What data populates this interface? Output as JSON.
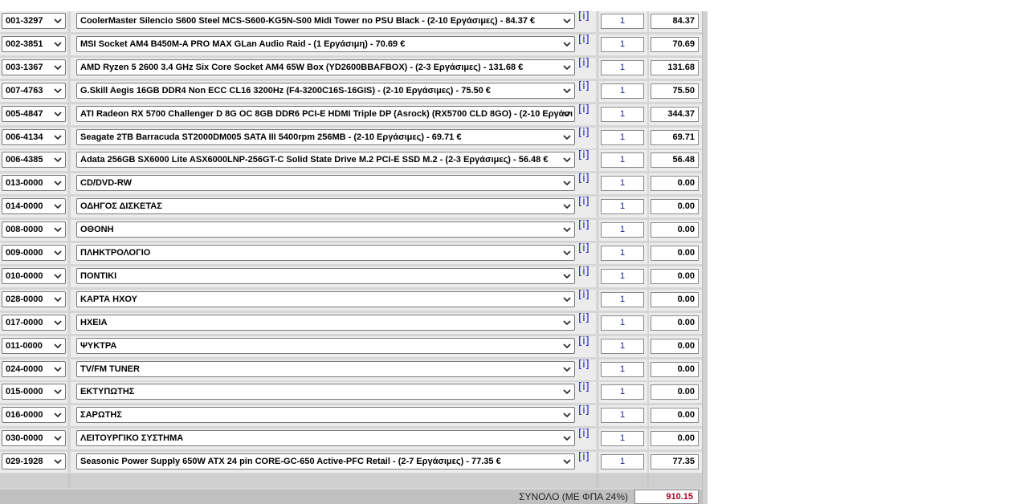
{
  "rows": [
    {
      "code": "001-3297",
      "product": "CoolerMaster Silencio S600 Steel MCS-S600-KG5N-S00 Midi Tower no PSU Black - (2-10 Εργάσιμες) - 84.37 €",
      "info": "[i]",
      "qty": "1",
      "price": "84.37"
    },
    {
      "code": "002-3851",
      "product": "MSI Socket AM4 B450M-A PRO MAX GLan Audio Raid - (1 Εργάσιμη) - 70.69 €",
      "info": "[i]",
      "qty": "1",
      "price": "70.69"
    },
    {
      "code": "003-1367",
      "product": "AMD Ryzen 5 2600 3.4 GHz Six Core Socket AM4 65W Box (YD2600BBAFBOX) - (2-3 Εργάσιμες) - 131.68 €",
      "info": "[i]",
      "qty": "1",
      "price": "131.68"
    },
    {
      "code": "007-4763",
      "product": "G.Skill Aegis 16GB DDR4 Non ECC CL16 3200Hz (F4-3200C16S-16GIS) - (2-10 Εργάσιμες) - 75.50 €",
      "info": "[i]",
      "qty": "1",
      "price": "75.50"
    },
    {
      "code": "005-4847",
      "product": "ATI Radeon RX 5700 Challenger D 8G OC 8GB DDR6 PCI-E HDMI Triple DP (Asrock) (RX5700 CLD 8GO) - (2-10 Εργάσι",
      "info": "[i]",
      "qty": "1",
      "price": "344.37"
    },
    {
      "code": "006-4134",
      "product": "Seagate 2TB Barracuda ST2000DM005 SATA III 5400rpm 256MB - (2-10 Εργάσιμες) - 69.71 €",
      "info": "[i]",
      "qty": "1",
      "price": "69.71"
    },
    {
      "code": "006-4385",
      "product": "Adata 256GB SX6000 Lite ASX6000LNP-256GT-C Solid State Drive M.2 PCI-E SSD M.2 - (2-3 Εργάσιμες) - 56.48 €",
      "info": "[i]",
      "qty": "1",
      "price": "56.48"
    },
    {
      "code": "013-0000",
      "product": "CD/DVD-RW",
      "info": "[i]",
      "qty": "1",
      "price": "0.00"
    },
    {
      "code": "014-0000",
      "product": "ΟΔΗΓΟΣ ΔΙΣΚΕΤΑΣ",
      "info": "[i]",
      "qty": "1",
      "price": "0.00"
    },
    {
      "code": "008-0000",
      "product": "ΟΘΟΝΗ",
      "info": "[i]",
      "qty": "1",
      "price": "0.00"
    },
    {
      "code": "009-0000",
      "product": "ΠΛΗΚΤΡΟΛΟΓΙΟ",
      "info": "[i]",
      "qty": "1",
      "price": "0.00"
    },
    {
      "code": "010-0000",
      "product": "ΠΟΝΤΙΚΙ",
      "info": "[i]",
      "qty": "1",
      "price": "0.00"
    },
    {
      "code": "028-0000",
      "product": "ΚΑΡΤΑ ΗΧΟΥ",
      "info": "[i]",
      "qty": "1",
      "price": "0.00"
    },
    {
      "code": "017-0000",
      "product": "ΗΧΕΙΑ",
      "info": "[i]",
      "qty": "1",
      "price": "0.00"
    },
    {
      "code": "011-0000",
      "product": "ΨΥΚΤΡΑ",
      "info": "[i]",
      "qty": "1",
      "price": "0.00"
    },
    {
      "code": "024-0000",
      "product": "TV/FM TUNER",
      "info": "[i]",
      "qty": "1",
      "price": "0.00"
    },
    {
      "code": "015-0000",
      "product": "ΕΚΤΥΠΩΤΗΣ",
      "info": "[i]",
      "qty": "1",
      "price": "0.00"
    },
    {
      "code": "016-0000",
      "product": "ΣΑΡΩΤΗΣ",
      "info": "[i]",
      "qty": "1",
      "price": "0.00"
    },
    {
      "code": "030-0000",
      "product": "ΛΕΙΤΟΥΡΓΙΚΟ ΣΥΣΤΗΜΑ",
      "info": "[i]",
      "qty": "1",
      "price": "0.00"
    },
    {
      "code": "029-1928",
      "product": "Seasonic Power Supply 650W ATX 24 pin CORE-GC-650 Active-PFC Retail - (2-7 Εργάσιμες) - 77.35 €",
      "info": "[i]",
      "qty": "1",
      "price": "77.35"
    }
  ],
  "total": {
    "label": "ΣΥΝΟΛΟ (ΜΕ ΦΠΑ 24%)",
    "value": "910.15"
  },
  "icons": {
    "dropdown": "chevron-down-icon",
    "info": "info-link-icon"
  },
  "colors": {
    "info_link": "#2222cc",
    "quantity_text": "#1a1a9a",
    "total_value": "#b00020"
  }
}
